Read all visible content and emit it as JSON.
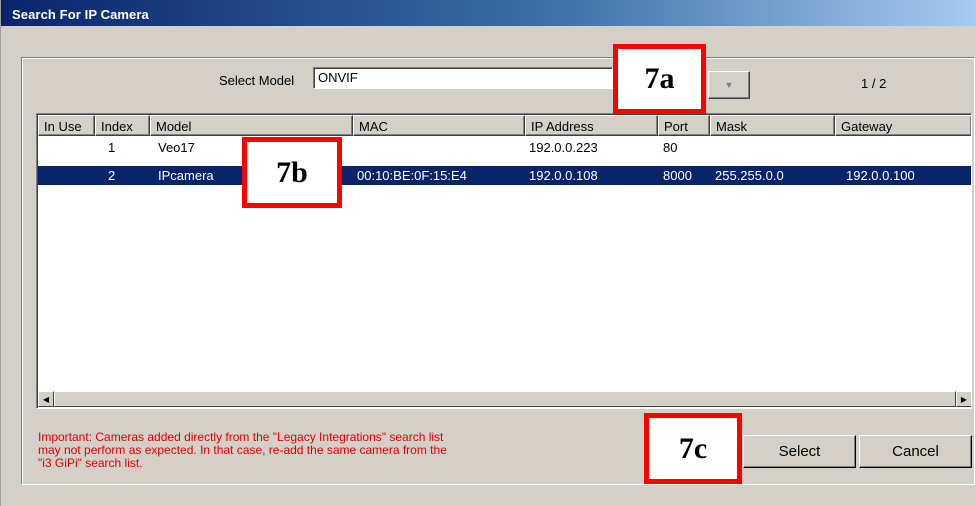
{
  "window": {
    "title": "Search For IP Camera"
  },
  "model_select": {
    "label": "Select Model",
    "value": "ONVIF"
  },
  "page_indicator": "1 / 2",
  "table": {
    "columns": [
      "In Use",
      "Index",
      "Model",
      "MAC",
      "IP Address",
      "Port",
      "Mask",
      "Gateway"
    ],
    "rows": [
      {
        "in_use": "",
        "index": "1",
        "model": "Veo17",
        "mac": "",
        "ip": "192.0.0.223",
        "port": "80",
        "mask": "",
        "gateway": "",
        "selected": false
      },
      {
        "in_use": "",
        "index": "2",
        "model": "IPcamera",
        "mac": "00:10:BE:0F:15:E4",
        "ip": "192.0.0.108",
        "port": "8000",
        "mask": "255.255.0.0",
        "gateway": "192.0.0.100",
        "selected": true
      }
    ]
  },
  "warning": {
    "lines": [
      "Important: Cameras added directly from the \"Legacy Integrations\" search list",
      "may not perform as expected. In that case, re-add the same camera from the",
      "\"i3 GiPi\" search list."
    ]
  },
  "buttons": {
    "select": "Select",
    "cancel": "Cancel"
  },
  "callouts": {
    "a": "7a",
    "b": "7b",
    "c": "7c"
  },
  "icons": {
    "dropdown": "chevron-down-icon",
    "scroll_left": "arrow-left-icon",
    "scroll_right": "arrow-right-icon"
  },
  "colors": {
    "selection": "#0a246a",
    "warning": "#e00000",
    "callout_border": "#ff0000",
    "dialog_bg": "#d4d0c8"
  }
}
